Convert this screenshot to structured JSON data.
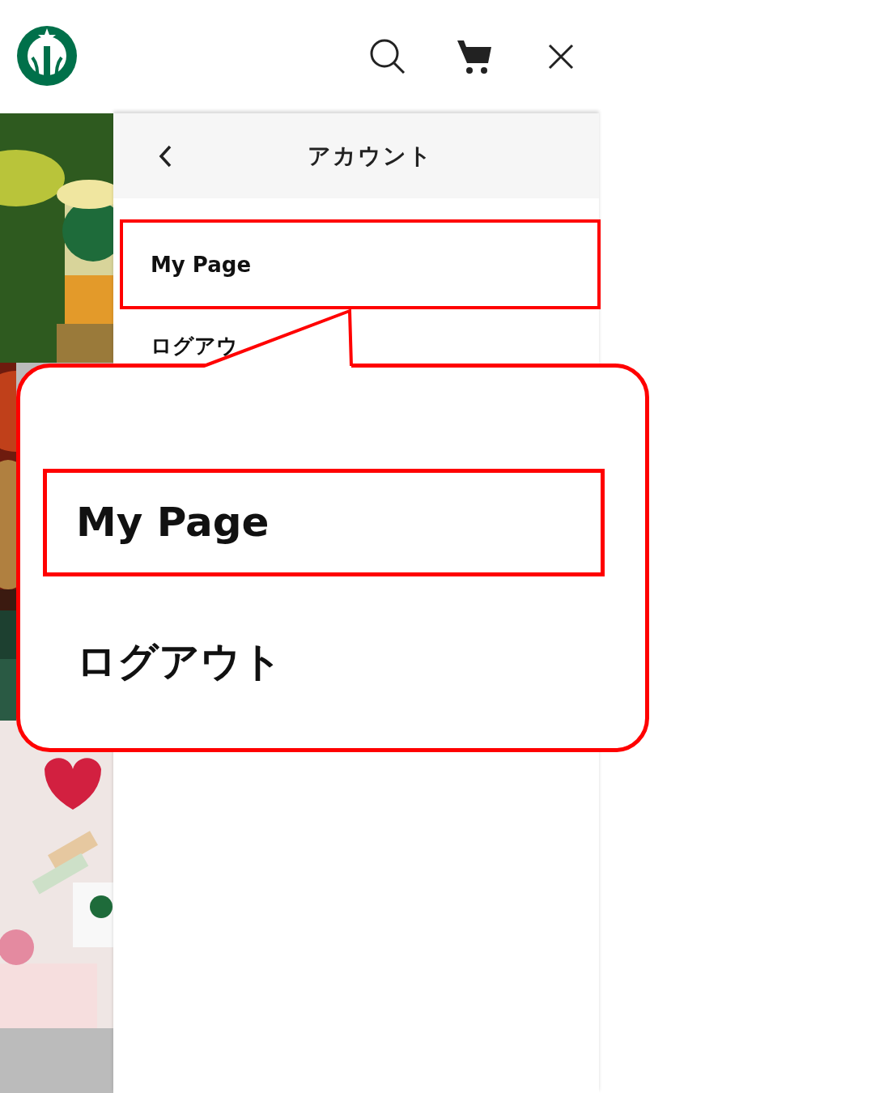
{
  "panel": {
    "title": "アカウント"
  },
  "menu": [
    {
      "label": "My Page",
      "highlighted": true
    },
    {
      "label": "ログアウ",
      "highlighted": false
    }
  ],
  "callout": {
    "items": [
      {
        "label": "My Page",
        "highlighted": true
      },
      {
        "label": "ログアウト",
        "highlighted": false
      }
    ]
  }
}
